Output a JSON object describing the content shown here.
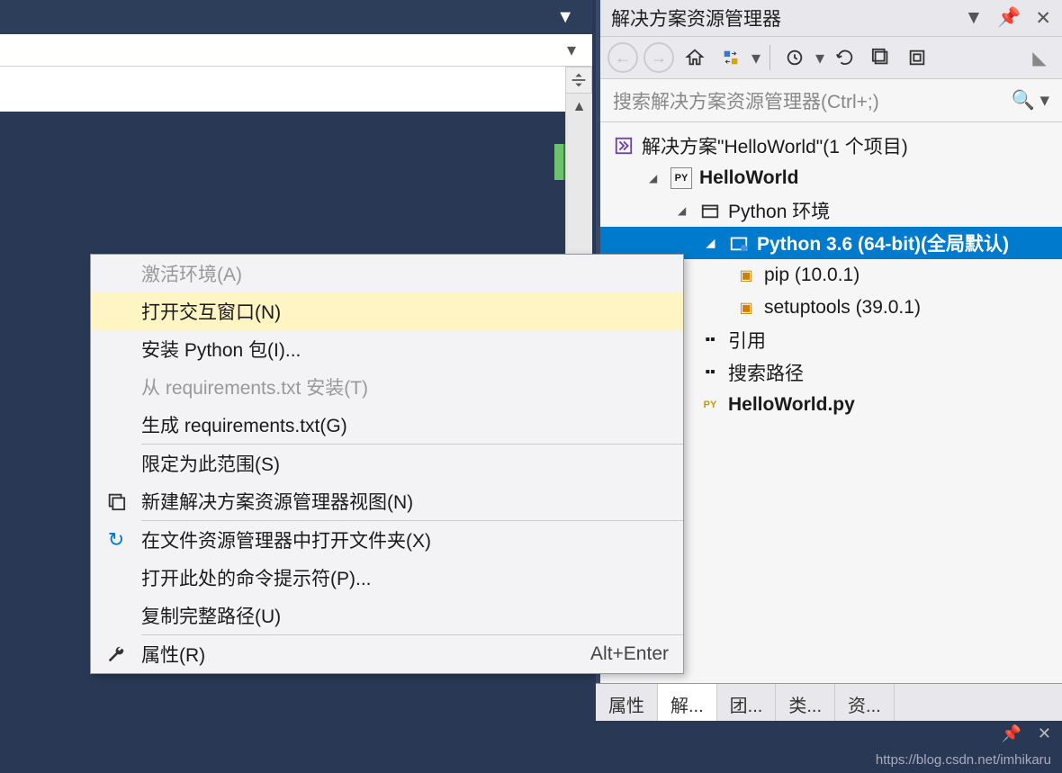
{
  "panel": {
    "title": "解决方案资源管理器",
    "search_placeholder": "搜索解决方案资源管理器(Ctrl+;)"
  },
  "tree": {
    "solution": "解决方案\"HelloWorld\"(1 个项目)",
    "project": "HelloWorld",
    "envs": "Python 环境",
    "python": "Python 3.6 (64-bit)(全局默认)",
    "pip": "pip (10.0.1)",
    "setuptools": "setuptools (39.0.1)",
    "references": "引用",
    "search_paths": "搜索路径",
    "file": "HelloWorld.py"
  },
  "menu": {
    "activate": "激活环境(A)",
    "interactive": "打开交互窗口(N)",
    "install_pkg": "安装 Python 包(I)...",
    "from_req": "从 requirements.txt 安装(T)",
    "gen_req": "生成 requirements.txt(G)",
    "scope": "限定为此范围(S)",
    "new_view": "新建解决方案资源管理器视图(N)",
    "open_explorer": "在文件资源管理器中打开文件夹(X)",
    "open_cmd": "打开此处的命令提示符(P)...",
    "copy_path": "复制完整路径(U)",
    "properties": "属性(R)",
    "properties_shortcut": "Alt+Enter"
  },
  "tabs": {
    "t1": "属性",
    "t2": "解...",
    "t3": "团...",
    "t4": "类...",
    "t5": "资..."
  },
  "watermark": "https://blog.csdn.net/imhikaru"
}
